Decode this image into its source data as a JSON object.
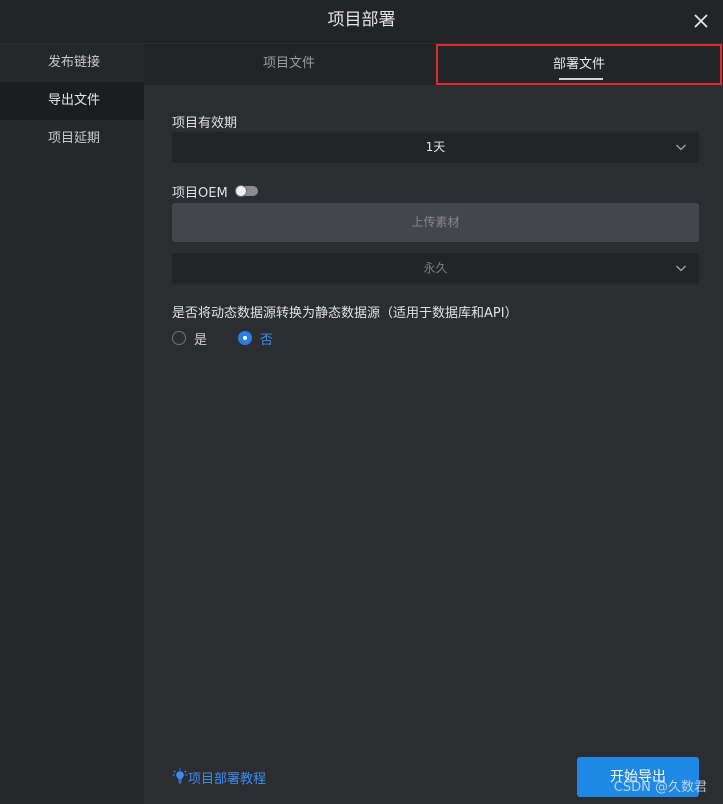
{
  "dialog": {
    "title": "项目部署",
    "close_icon": "close-icon"
  },
  "sidebar": {
    "items": [
      {
        "label": "发布链接",
        "active": false
      },
      {
        "label": "导出文件",
        "active": true
      },
      {
        "label": "项目延期",
        "active": false
      }
    ]
  },
  "tabs": [
    {
      "label": "项目文件",
      "active": false
    },
    {
      "label": "部署文件",
      "active": true
    }
  ],
  "form": {
    "validity_label": "项目有效期",
    "validity_value": "1天",
    "oem_label": "项目OEM",
    "oem_enabled": false,
    "upload_label": "上传素材",
    "oem_validity_value": "永久",
    "convert_question": "是否将动态数据源转换为静态数据源（适用于数据库和API）",
    "convert_options": [
      "是",
      "否"
    ],
    "convert_selected": "否"
  },
  "footer": {
    "tutorial_link": "项目部署教程",
    "export_button": "开始导出"
  },
  "watermark": "CSDN @久数君",
  "colors": {
    "accent": "#1e88e5",
    "link": "#3b8cf0",
    "highlight_border": "#e02b2b"
  }
}
